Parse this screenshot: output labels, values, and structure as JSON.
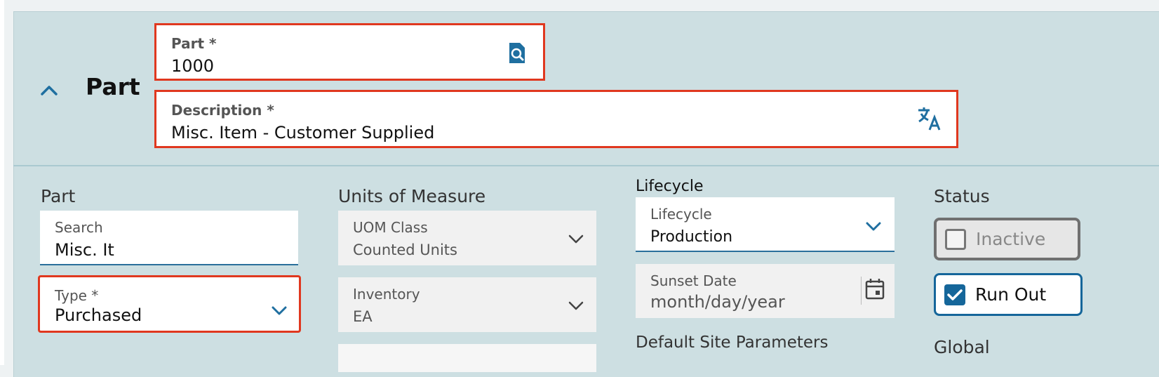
{
  "header": {
    "section_title": "Part",
    "part_field": {
      "label": "Part *",
      "value": "1000"
    },
    "description_field": {
      "label": "Description *",
      "value": "Misc. Item - Customer Supplied"
    }
  },
  "columns": {
    "part": {
      "title": "Part",
      "search": {
        "label": "Search",
        "value": "Misc. It"
      },
      "type": {
        "label": "Type *",
        "value": "Purchased"
      }
    },
    "uom": {
      "title": "Units of Measure",
      "uom_class": {
        "label": "UOM Class",
        "value": "Counted Units"
      },
      "inventory": {
        "label": "Inventory",
        "value": "EA"
      }
    },
    "lifecycle": {
      "title": "Lifecycle",
      "lifecycle": {
        "label": "Lifecycle",
        "value": "Production"
      },
      "sunset_date": {
        "label": "Sunset Date",
        "placeholder": "month/day/year"
      },
      "default_site_title": "Default Site Parameters"
    },
    "status": {
      "title": "Status",
      "inactive": {
        "label": "Inactive",
        "checked": false
      },
      "run_out": {
        "label": "Run Out",
        "checked": true
      },
      "global_title": "Global"
    }
  },
  "colors": {
    "panel_bg": "#cddfe2",
    "accent": "#15669a",
    "required_border": "#e0381f"
  },
  "icons": [
    "chevron-up-icon",
    "search-icon",
    "translate-icon",
    "chevron-down-icon",
    "calendar-icon",
    "check-icon"
  ]
}
